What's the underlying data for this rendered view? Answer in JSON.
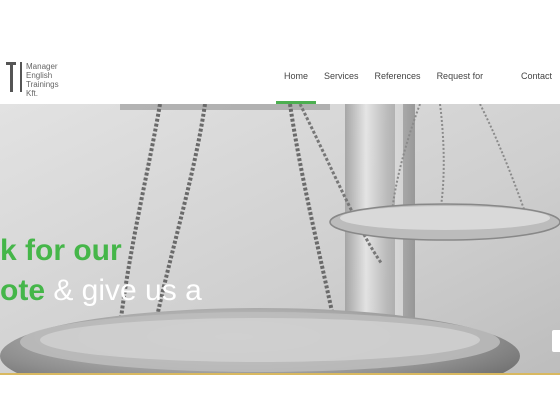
{
  "brand": {
    "logo_letter": "T",
    "lines": [
      "Manager",
      "English",
      "Trainings",
      "Kft."
    ]
  },
  "nav": {
    "items": [
      {
        "label": "Home",
        "active": true
      },
      {
        "label": "Services",
        "active": false
      },
      {
        "label": "References",
        "active": false
      },
      {
        "label": "Request for Quote",
        "active": false
      },
      {
        "label": "Contact",
        "active": false
      }
    ]
  },
  "hero": {
    "line1": "k for our",
    "line2_green": "ote",
    "line2_rest": " & give us a"
  },
  "colors": {
    "accent": "#45b649",
    "nav_underline": "#4caf50",
    "footer_line": "#d8b860"
  }
}
